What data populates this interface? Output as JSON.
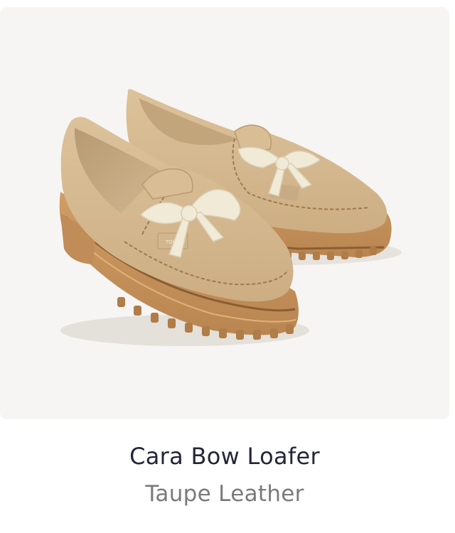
{
  "product": {
    "name": "Cara Bow Loafer",
    "variant": "Taupe Leather",
    "image_alt": "Cara Bow Loafer in Taupe Leather",
    "tag_text": "TOMS"
  },
  "colors": {
    "panel_background": "#f6f5f3",
    "leather": "#d6b88e",
    "sole": "#c9955e",
    "bow": "#f1ead7",
    "name_text": "#25253a",
    "variant_text": "#7a7a7e"
  }
}
